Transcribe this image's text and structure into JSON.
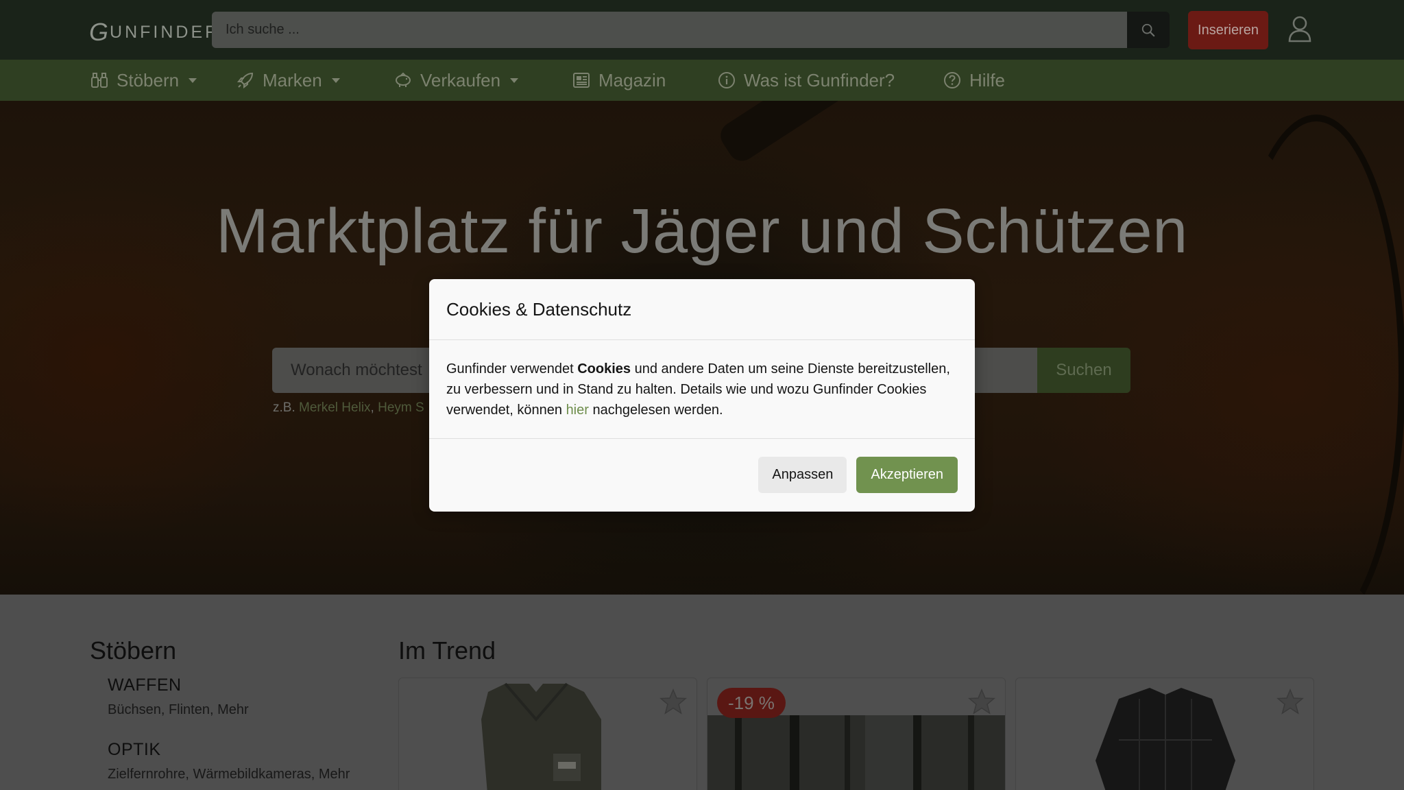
{
  "header": {
    "logo_initial": "G",
    "logo_rest": "UNFINDER",
    "search_placeholder": "Ich suche ...",
    "insert_label": "Inserieren"
  },
  "nav": {
    "items": [
      {
        "label": "Stöbern",
        "icon": "binoculars-icon",
        "dropdown": true
      },
      {
        "label": "Marken",
        "icon": "rocket-icon",
        "dropdown": true
      },
      {
        "label": "Verkaufen",
        "icon": "piggy-bank-icon",
        "dropdown": true
      },
      {
        "label": "Magazin",
        "icon": "newspaper-icon",
        "dropdown": false
      },
      {
        "label": "Was ist Gunfinder?",
        "icon": "info-circle-icon",
        "dropdown": false
      },
      {
        "label": "Hilfe",
        "icon": "question-circle-icon",
        "dropdown": false
      }
    ]
  },
  "hero": {
    "title": "Marktplatz für Jäger und Schützen",
    "search_placeholder": "Wonach möchtest",
    "search_button": "Suchen",
    "examples_prefix": "z.B.",
    "example_1": "Merkel Helix",
    "example_sep": ",",
    "example_2": "Heym S"
  },
  "browse": {
    "title": "Stöbern",
    "categories": [
      {
        "name": "WAFFEN",
        "sub": "Büchsen, Flinten, Mehr"
      },
      {
        "name": "OPTIK",
        "sub": "Zielfernrohre, Wärmebildkameras, Mehr"
      }
    ]
  },
  "trend": {
    "title": "Im Trend",
    "cards": [
      {
        "image": "vest"
      },
      {
        "image": "forest",
        "badge": "-19 %"
      },
      {
        "image": "shirt"
      }
    ]
  },
  "cookie_modal": {
    "title": "Cookies & Datenschutz",
    "text_1": "Gunfinder verwendet ",
    "text_bold": "Cookies",
    "text_2": " und andere Daten um seine Dienste bereitzustellen, zu verbessern und in Stand zu halten. Details wie und wozu Gunfinder Cookies verwendet, können ",
    "link": "hier",
    "text_3": " nachgelesen werden.",
    "adjust_button": "Anpassen",
    "accept_button": "Akzeptieren"
  },
  "colors": {
    "topbar": "#1a2319",
    "navbar": "#2f3f22",
    "accent_green": "#71924f",
    "insert_red": "#6b1a14"
  }
}
